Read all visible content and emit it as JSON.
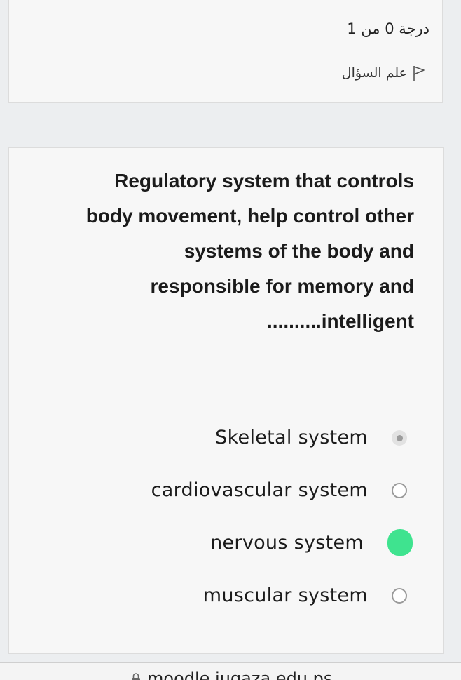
{
  "info": {
    "grade_text": "درجة 0 من 1",
    "flag_label": "علم السؤال"
  },
  "question": {
    "lines": [
      "Regulatory system that controls",
      "body movement, help control other",
      "systems of the body and",
      "responsible for memory and",
      "..........intelligent"
    ]
  },
  "options": [
    {
      "label": "Skeletal system",
      "state": "selected"
    },
    {
      "label": "cardiovascular system",
      "state": "unselected"
    },
    {
      "label": "nervous system",
      "state": "marked"
    },
    {
      "label": "muscular system",
      "state": "unselected"
    }
  ],
  "browser": {
    "url": "moodle.iugaza.edu.ps"
  },
  "icons": {
    "flag": "flag-icon",
    "lock": "lock-icon"
  },
  "colors": {
    "mark": "#3fe38f"
  }
}
